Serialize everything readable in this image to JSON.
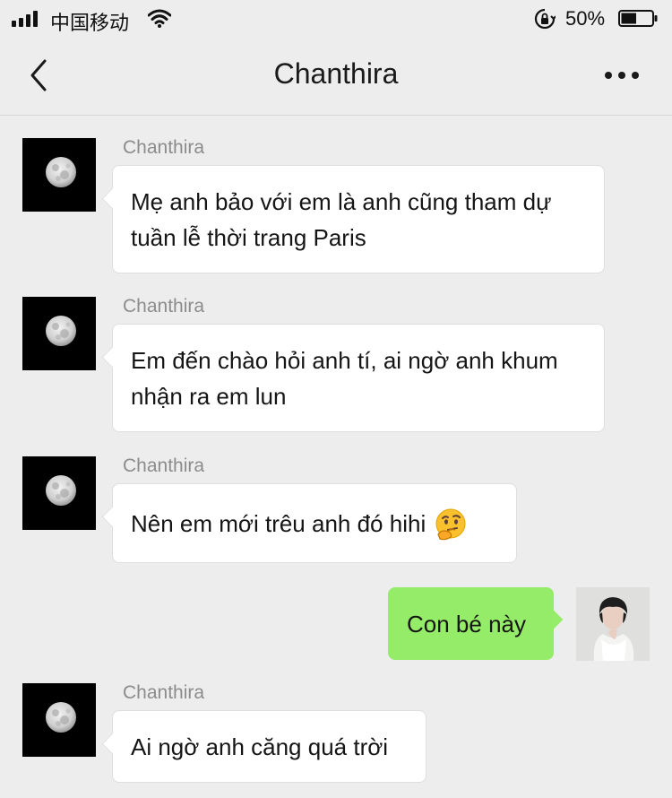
{
  "status_bar": {
    "carrier": "中国移动",
    "battery": "50%",
    "battery_level": 0.5
  },
  "header": {
    "title": "Chanthira",
    "icons": [
      "chevron-left-icon",
      "more-dots-icon"
    ]
  },
  "messages": [
    {
      "sender": "Chanthira",
      "direction": "incoming",
      "text": "Mẹ anh bảo với em là anh cũng tham dự tuần lễ thời trang Paris"
    },
    {
      "sender": "Chanthira",
      "direction": "incoming",
      "text": "Em đến chào hỏi anh tí, ai ngờ anh khum nhận ra em lun"
    },
    {
      "sender": "Chanthira",
      "direction": "incoming",
      "text": "Nên em mới trêu anh đó hihi",
      "emoji": "thinking-face-emoji"
    },
    {
      "direction": "outgoing",
      "text": "Con bé này"
    },
    {
      "sender": "Chanthira",
      "direction": "incoming",
      "text": "Ai ngờ anh căng quá trời"
    }
  ],
  "colors": {
    "background": "#ededed",
    "incoming_bubble": "#ffffff",
    "outgoing_bubble": "#95ec69",
    "sender_name": "#8c8c8c"
  }
}
